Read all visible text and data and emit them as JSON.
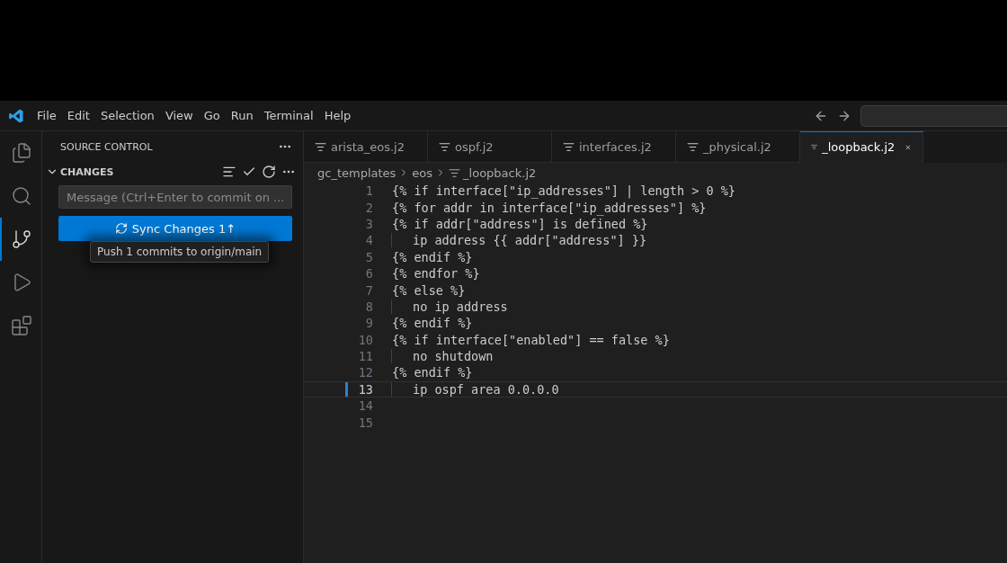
{
  "menu": [
    "File",
    "Edit",
    "Selection",
    "View",
    "Go",
    "Run",
    "Terminal",
    "Help"
  ],
  "activity_bar": [
    {
      "kind": "explorer",
      "selected": false
    },
    {
      "kind": "search",
      "selected": false
    },
    {
      "kind": "source-control",
      "selected": true
    },
    {
      "kind": "run",
      "selected": false
    },
    {
      "kind": "extensions",
      "selected": false
    }
  ],
  "sidebar": {
    "title": "SOURCE CONTROL",
    "section": {
      "title": "CHANGES",
      "expanded": true
    },
    "message": {
      "placeholder": "Message (Ctrl+Enter to commit on ..."
    },
    "sync_button": {
      "label": "Sync Changes 1↑"
    },
    "tooltip": "Push 1 commits to origin/main"
  },
  "tabs": [
    {
      "label": "arista_eos.j2",
      "selected": false
    },
    {
      "label": "ospf.j2",
      "selected": false
    },
    {
      "label": "interfaces.j2",
      "selected": false
    },
    {
      "label": "_physical.j2",
      "selected": false
    },
    {
      "label": "_loopback.j2",
      "selected": true
    }
  ],
  "breadcrumbs": [
    "gc_templates",
    "eos",
    "_loopback.j2"
  ],
  "lines": [
    {
      "number": "1",
      "kind": "plain",
      "text": "{% if interface[\"ip_addresses\"] | length > 0 %}",
      "current": false,
      "modified": false
    },
    {
      "number": "2",
      "kind": "plain",
      "text": "{% for addr in interface[\"ip_addresses\"] %}",
      "current": false,
      "modified": false
    },
    {
      "number": "3",
      "kind": "plain",
      "text": "{% if addr[\"address\"] is defined %}",
      "current": false,
      "modified": false
    },
    {
      "number": "4",
      "kind": "nested",
      "text": "ip address {{ addr[\"address\"] }}",
      "current": false,
      "modified": false
    },
    {
      "number": "5",
      "kind": "plain",
      "text": "{% endif %}",
      "current": false,
      "modified": false
    },
    {
      "number": "6",
      "kind": "plain",
      "text": "{% endfor %}",
      "current": false,
      "modified": false
    },
    {
      "number": "7",
      "kind": "plain",
      "text": "{% else %}",
      "current": false,
      "modified": false
    },
    {
      "number": "8",
      "kind": "nested",
      "text": "no ip address",
      "current": false,
      "modified": false
    },
    {
      "number": "9",
      "kind": "plain",
      "text": "{% endif %}",
      "current": false,
      "modified": false
    },
    {
      "number": "10",
      "kind": "plain",
      "text": "{% if interface[\"enabled\"] == false %}",
      "current": false,
      "modified": false
    },
    {
      "number": "11",
      "kind": "nested",
      "text": "no shutdown",
      "current": false,
      "modified": false
    },
    {
      "number": "12",
      "kind": "plain",
      "text": "{% endif %}",
      "current": false,
      "modified": false
    },
    {
      "number": "13",
      "kind": "nested",
      "text": "ip ospf area 0.0.0.0",
      "current": true,
      "modified": true
    },
    {
      "number": "14",
      "kind": "plain",
      "current": false,
      "modified": false
    },
    {
      "number": "15",
      "kind": "plain",
      "current": false,
      "modified": false
    }
  ]
}
